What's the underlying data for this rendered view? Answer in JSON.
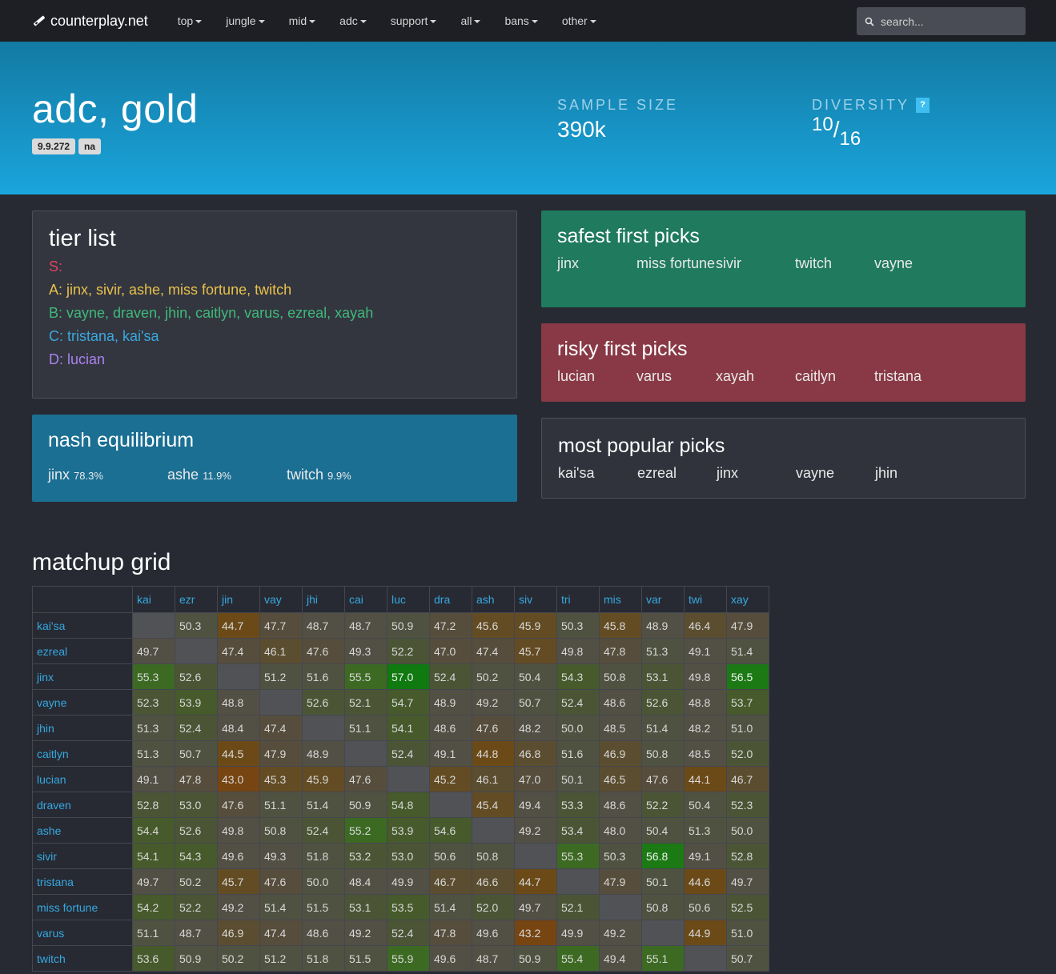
{
  "nav": {
    "brand": "counterplay.net",
    "items": [
      "top",
      "jungle",
      "mid",
      "adc",
      "support",
      "all",
      "bans",
      "other"
    ],
    "search_placeholder": "search..."
  },
  "hero": {
    "title": "adc, gold",
    "badges": [
      "9.9.272",
      "na"
    ],
    "sample_label": "SAMPLE SIZE",
    "sample_value": "390k",
    "diversity_label": "DIVERSITY",
    "diversity_help": "?",
    "diversity_num": "10",
    "diversity_den": "16"
  },
  "tier_list": {
    "title": "tier list",
    "rows": [
      {
        "text": "S:",
        "color": "#e0445f"
      },
      {
        "text": "A: jinx, sivir, ashe, miss fortune, twitch",
        "color": "#e8c14a"
      },
      {
        "text": "B: vayne, draven, jhin, caitlyn, varus, ezreal, xayah",
        "color": "#3fb97a"
      },
      {
        "text": "C: tristana, kai'sa",
        "color": "#3aa8de"
      },
      {
        "text": "D: lucian",
        "color": "#a983ee"
      }
    ]
  },
  "nash": {
    "title": "nash equilibrium",
    "items": [
      {
        "name": "jinx",
        "pct": "78.3%"
      },
      {
        "name": "ashe",
        "pct": "11.9%"
      },
      {
        "name": "twitch",
        "pct": "9.9%"
      }
    ]
  },
  "safe": {
    "title": "safest first picks",
    "picks": [
      "jinx",
      "miss fortune",
      "sivir",
      "twitch",
      "vayne"
    ]
  },
  "risky": {
    "title": "risky first picks",
    "picks": [
      "lucian",
      "varus",
      "xayah",
      "caitlyn",
      "tristana"
    ]
  },
  "popular": {
    "title": "most popular picks",
    "picks": [
      "kai'sa",
      "ezreal",
      "jinx",
      "vayne",
      "jhin"
    ]
  },
  "matchup": {
    "title": "matchup grid",
    "columns": [
      "kai",
      "ezr",
      "jin",
      "vay",
      "jhi",
      "cai",
      "luc",
      "dra",
      "ash",
      "siv",
      "tri",
      "mis",
      "var",
      "twi",
      "xay"
    ],
    "rows": [
      {
        "name": "kai'sa",
        "values": [
          "",
          "50.3",
          "44.7",
          "47.7",
          "48.7",
          "48.7",
          "50.9",
          "47.2",
          "45.6",
          "45.9",
          "50.3",
          "45.8",
          "48.9",
          "46.4",
          "47.9"
        ]
      },
      {
        "name": "ezreal",
        "values": [
          "49.7",
          "",
          "47.4",
          "46.1",
          "47.6",
          "49.3",
          "52.2",
          "47.0",
          "47.4",
          "45.7",
          "49.8",
          "47.8",
          "51.3",
          "49.1",
          "51.4"
        ]
      },
      {
        "name": "jinx",
        "values": [
          "55.3",
          "52.6",
          "",
          "51.2",
          "51.6",
          "55.5",
          "57.0",
          "52.4",
          "50.2",
          "50.4",
          "54.3",
          "50.8",
          "53.1",
          "49.8",
          "56.5"
        ]
      },
      {
        "name": "vayne",
        "values": [
          "52.3",
          "53.9",
          "48.8",
          "",
          "52.6",
          "52.1",
          "54.7",
          "48.9",
          "49.2",
          "50.7",
          "52.4",
          "48.6",
          "52.6",
          "48.8",
          "53.7"
        ]
      },
      {
        "name": "jhin",
        "values": [
          "51.3",
          "52.4",
          "48.4",
          "47.4",
          "",
          "51.1",
          "54.1",
          "48.6",
          "47.6",
          "48.2",
          "50.0",
          "48.5",
          "51.4",
          "48.2",
          "51.0"
        ]
      },
      {
        "name": "caitlyn",
        "values": [
          "51.3",
          "50.7",
          "44.5",
          "47.9",
          "48.9",
          "",
          "52.4",
          "49.1",
          "44.8",
          "46.8",
          "51.6",
          "46.9",
          "50.8",
          "48.5",
          "52.0"
        ]
      },
      {
        "name": "lucian",
        "values": [
          "49.1",
          "47.8",
          "43.0",
          "45.3",
          "45.9",
          "47.6",
          "",
          "45.2",
          "46.1",
          "47.0",
          "50.1",
          "46.5",
          "47.6",
          "44.1",
          "46.7"
        ]
      },
      {
        "name": "draven",
        "values": [
          "52.8",
          "53.0",
          "47.6",
          "51.1",
          "51.4",
          "50.9",
          "54.8",
          "",
          "45.4",
          "49.4",
          "53.3",
          "48.6",
          "52.2",
          "50.4",
          "52.3"
        ]
      },
      {
        "name": "ashe",
        "values": [
          "54.4",
          "52.6",
          "49.8",
          "50.8",
          "52.4",
          "55.2",
          "53.9",
          "54.6",
          "",
          "49.2",
          "53.4",
          "48.0",
          "50.4",
          "51.3",
          "50.0"
        ]
      },
      {
        "name": "sivir",
        "values": [
          "54.1",
          "54.3",
          "49.6",
          "49.3",
          "51.8",
          "53.2",
          "53.0",
          "50.6",
          "50.8",
          "",
          "55.3",
          "50.3",
          "56.8",
          "49.1",
          "52.8"
        ]
      },
      {
        "name": "tristana",
        "values": [
          "49.7",
          "50.2",
          "45.7",
          "47.6",
          "50.0",
          "48.4",
          "49.9",
          "46.7",
          "46.6",
          "44.7",
          "",
          "47.9",
          "50.1",
          "44.6",
          "49.7"
        ]
      },
      {
        "name": "miss fortune",
        "values": [
          "54.2",
          "52.2",
          "49.2",
          "51.4",
          "51.5",
          "53.1",
          "53.5",
          "51.4",
          "52.0",
          "49.7",
          "52.1",
          "",
          "50.8",
          "50.6",
          "52.5"
        ]
      },
      {
        "name": "varus",
        "values": [
          "51.1",
          "48.7",
          "46.9",
          "47.4",
          "48.6",
          "49.2",
          "52.4",
          "47.8",
          "49.6",
          "43.2",
          "49.9",
          "49.2",
          "",
          "44.9",
          "51.0"
        ]
      },
      {
        "name": "twitch",
        "values": [
          "53.6",
          "50.9",
          "50.2",
          "51.2",
          "51.8",
          "51.5",
          "55.9",
          "49.6",
          "48.7",
          "50.9",
          "55.4",
          "49.4",
          "55.1",
          "",
          "50.7"
        ]
      }
    ]
  }
}
